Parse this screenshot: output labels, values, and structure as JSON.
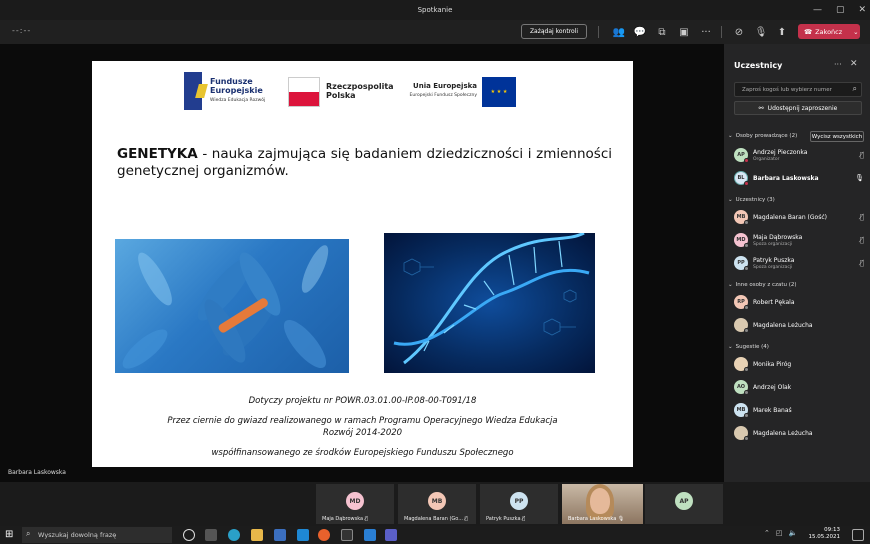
{
  "window": {
    "title": "Spotkanie"
  },
  "toolbar": {
    "timer": "--:--",
    "request_control": "Zażądaj kontroli",
    "leave": "Zakończ"
  },
  "slide": {
    "logos": {
      "fe_title": "Fundusze",
      "fe_title2": "Europejskie",
      "fe_sub": "Wiedza Edukacja Rozwój",
      "pl_text1": "Rzeczpospolita",
      "pl_text2": "Polska",
      "eu_title": "Unia Europejska",
      "eu_sub": "Europejski Fundusz Społeczny"
    },
    "title_bold": "GENETYKA",
    "title_rest": " - nauka zajmująca się badaniem dziedziczności i zmienności genetycznej organizmów.",
    "caption1": "Dotyczy projektu nr POWR.03.01.00-IP.08-00-T091/18",
    "caption2": "Przez ciernie do gwiazd realizowanego w ramach Programu Operacyjnego Wiedza Edukacja",
    "caption3": "Rozwój 2014-2020",
    "caption4": "współfinansowanego ze środków Europejskiego Funduszu Społecznego"
  },
  "presenter_label": "Barbara Laskowska",
  "panel": {
    "title": "Uczestnicy",
    "search_placeholder": "Zaproś kogoś lub wybierz numer",
    "share_label": "Udostępnij zaproszenie",
    "mute_all": "Wycisz wszystkich",
    "sections": [
      {
        "label": "Osoby prowadzące (2)"
      },
      {
        "label": "Uczestnicy (3)"
      },
      {
        "label": "Inne osoby z czatu (2)"
      },
      {
        "label": "Sugestie (4)"
      }
    ],
    "presenters": [
      {
        "initials": "AP",
        "name": "Andrzej Pieczonka",
        "sub": "Organizator",
        "color": "#bfe0c0"
      },
      {
        "initials": "BL",
        "name": "Barbara Laskowska",
        "sub": "",
        "color": "#d8e7f5"
      }
    ],
    "attendees": [
      {
        "initials": "MB",
        "name": "Magdalena Baran (Gość)",
        "sub": "",
        "color": "#f3c7b6"
      },
      {
        "initials": "MD",
        "name": "Maja Dąbrowska",
        "sub": "Spoza organizacji",
        "color": "#f5c2d0"
      },
      {
        "initials": "PP",
        "name": "Patryk Puszka",
        "sub": "Spoza organizacji",
        "color": "#cde3f0"
      }
    ],
    "chat_others": [
      {
        "initials": "RP",
        "name": "Robert Pękala",
        "color": "#f3c7b6"
      },
      {
        "initials": "ML",
        "name": "Magdalena Leżucha",
        "color": "#d9c9b0"
      }
    ],
    "suggestions": [
      {
        "initials": "MP",
        "name": "Monika Piróg",
        "color": "#e8d2b5"
      },
      {
        "initials": "AO",
        "name": "Andrzej Olak",
        "color": "#bfe0c0"
      },
      {
        "initials": "MB",
        "name": "Marek Banaś",
        "color": "#cde3f0"
      },
      {
        "initials": "ML",
        "name": "Magdalena Leżucha",
        "color": "#d9c9b0"
      }
    ]
  },
  "gallery": [
    {
      "initials": "MD",
      "label": "Maja Dąbrowska",
      "color": "#f5c2d0"
    },
    {
      "initials": "MB",
      "label": "Magdalena Baran (Go...",
      "color": "#f3c7b6"
    },
    {
      "initials": "PP",
      "label": "Patryk Puszka",
      "color": "#cde3f0"
    },
    {
      "initials": "",
      "label": "Barbara Laskowska",
      "color": ""
    },
    {
      "initials": "AP",
      "label": "",
      "color": "#bfe0c0"
    }
  ],
  "taskbar": {
    "search_placeholder": "Wyszukaj dowolną frazę",
    "time": "09:13",
    "date": "15.05.2021"
  }
}
